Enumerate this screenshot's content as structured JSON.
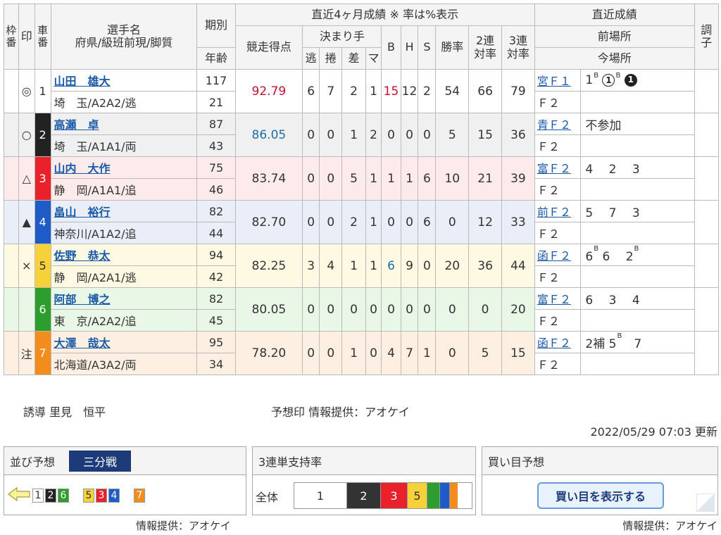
{
  "header": {
    "frame": "枠\n番",
    "mark": "印",
    "car": "車\n番",
    "rider": "選手名",
    "rider_sub": "府県/級班前現/脚質",
    "term": "期別",
    "age": "年齢",
    "recent4": "直近4ヶ月成績 ※ 率は%表示",
    "score": "競走得点",
    "kimarite": "決まり手",
    "k1": "逃",
    "k2": "捲",
    "k3": "差",
    "k4": "マ",
    "b": "B",
    "h": "H",
    "s": "S",
    "win": "勝率",
    "ren2": "2連\n対率",
    "ren3": "3連\n対率",
    "recent": "直近成績",
    "prev_venue": "前場所",
    "this_venue": "今場所",
    "condition": "調\n子"
  },
  "riders": [
    {
      "frame": "",
      "mark": "◎",
      "car": "1",
      "name": "山田　雄大",
      "pref": "埼　玉/A2A2/逃",
      "term": "117",
      "age": "21",
      "score": "92.79",
      "k1": "6",
      "k2": "7",
      "k3": "2",
      "k4": "1",
      "b": "15",
      "h": "12",
      "s": "2",
      "win": "54",
      "r2": "66",
      "r3": "79",
      "prev_label": "宮Ｆ１",
      "this_label": "Ｆ２",
      "recent": "1",
      "bg": "#ffffff",
      "frame_bg": "#ffffff",
      "frame_color": "#333",
      "score_color": "#c8102e",
      "b_color": "#c8102e"
    },
    {
      "frame": "",
      "mark": "○",
      "car": "2",
      "name": "高瀬　卓",
      "pref": "埼　玉/A1A1/両",
      "term": "87",
      "age": "43",
      "score": "86.05",
      "k1": "0",
      "k2": "0",
      "k3": "1",
      "k4": "2",
      "b": "0",
      "h": "0",
      "s": "0",
      "win": "5",
      "r2": "15",
      "r3": "36",
      "prev_label": "青Ｆ２",
      "this_label": "Ｆ２",
      "recent": "不参加",
      "bg": "#f0f0f0",
      "frame_bg": "#222222",
      "frame_color": "#fff",
      "score_color": "#1a6fa8",
      "b_color": "#333"
    },
    {
      "frame": "",
      "mark": "△",
      "car": "3",
      "name": "山内　大作",
      "pref": "静　岡/A1A1/追",
      "term": "75",
      "age": "46",
      "score": "83.74",
      "k1": "0",
      "k2": "0",
      "k3": "5",
      "k4": "1",
      "b": "1",
      "h": "1",
      "s": "6",
      "win": "10",
      "r2": "21",
      "r3": "39",
      "prev_label": "富Ｆ２",
      "this_label": "Ｆ２",
      "recent": "4　 2　 3",
      "bg": "#fdeaea",
      "frame_bg": "#e8212b",
      "frame_color": "#fff",
      "score_color": "#333",
      "b_color": "#333"
    },
    {
      "frame": "",
      "mark": "▲",
      "car": "4",
      "name": "畠山　裕行",
      "pref": "神奈川/A1A2/追",
      "term": "82",
      "age": "44",
      "score": "82.70",
      "k1": "0",
      "k2": "0",
      "k3": "2",
      "k4": "1",
      "b": "0",
      "h": "0",
      "s": "6",
      "win": "0",
      "r2": "12",
      "r3": "33",
      "prev_label": "前Ｆ２",
      "this_label": "Ｆ２",
      "recent": "5　 7　 3",
      "bg": "#e9eef9",
      "frame_bg": "#1f5bc6",
      "frame_color": "#fff",
      "score_color": "#333",
      "b_color": "#333"
    },
    {
      "frame": "",
      "mark": "×",
      "car": "5",
      "name": "佐野　恭太",
      "pref": "静　岡/A2A1/逃",
      "term": "94",
      "age": "42",
      "score": "82.25",
      "k1": "3",
      "k2": "4",
      "k3": "1",
      "k4": "1",
      "b": "6",
      "h": "9",
      "s": "0",
      "win": "20",
      "r2": "36",
      "r3": "44",
      "prev_label": "函Ｆ２",
      "this_label": "Ｆ２",
      "recent": "6",
      "bg": "#fdf9e3",
      "frame_bg": "#f7d13a",
      "frame_color": "#333",
      "score_color": "#333",
      "b_color": "#1a6fa8"
    },
    {
      "frame": "",
      "mark": "",
      "car": "6",
      "name": "阿部　博之",
      "pref": "東　京/A2A2/追",
      "term": "82",
      "age": "45",
      "score": "80.05",
      "k1": "0",
      "k2": "0",
      "k3": "0",
      "k4": "0",
      "b": "0",
      "h": "0",
      "s": "0",
      "win": "0",
      "r2": "0",
      "r3": "20",
      "prev_label": "富Ｆ２",
      "this_label": "Ｆ２",
      "recent": "6　 3　 4",
      "bg": "#e8f7e6",
      "frame_bg": "#2d9e2d",
      "frame_color": "#fff",
      "score_color": "#333",
      "b_color": "#333"
    },
    {
      "frame": "",
      "mark": "注",
      "car": "7",
      "name": "大澤　哉太",
      "pref": "北海道/A3A2/両",
      "term": "95",
      "age": "34",
      "score": "78.20",
      "k1": "0",
      "k2": "0",
      "k3": "1",
      "k4": "0",
      "b": "4",
      "h": "7",
      "s": "1",
      "win": "0",
      "r2": "5",
      "r3": "15",
      "prev_label": "函Ｆ２",
      "this_label": "Ｆ２",
      "recent": "2補",
      "bg": "#fdf0e3",
      "frame_bg": "#f28c1c",
      "frame_color": "#fff",
      "score_color": "#333",
      "b_color": "#333"
    }
  ],
  "recent_extra": {
    "r1_b1": "B",
    "r1_c2": "1",
    "r1_b2": "B",
    "r1_c3": "1",
    "r5_b1": "B",
    "r5_p2": "6",
    "r5_p3": "2",
    "r5_b3": "B",
    "r7_p2": "5",
    "r7_b2": "B",
    "r7_p3": "7"
  },
  "footer": {
    "lead": "誘導 里見　恒平",
    "mark_source": "予想印 情報提供：アオケイ",
    "updated": "2022/05/29 07:03 更新",
    "credit_left": "情報提供：アオケイ",
    "credit_right": "情報提供：アオケイ"
  },
  "line_box": {
    "title": "並び予想",
    "tag": "三分戦",
    "groups": [
      [
        "1",
        "2",
        "6"
      ],
      [
        "5",
        "3",
        "4"
      ],
      [
        "7"
      ]
    ]
  },
  "support_box": {
    "title": "3連単支持率",
    "label": "全体",
    "segments": [
      {
        "text": "1",
        "color": "#ffffff",
        "fg": "#333"
      },
      {
        "text": "2",
        "color": "#333333",
        "fg": "#fff"
      },
      {
        "text": "3",
        "color": "#e8212b",
        "fg": "#fff"
      },
      {
        "text": "5",
        "color": "#f7d13a",
        "fg": "#333"
      },
      {
        "text": "",
        "color": "#2d9e2d",
        "fg": "#fff"
      },
      {
        "text": "",
        "color": "#1f5bc6",
        "fg": "#fff"
      },
      {
        "text": "",
        "color": "#f28c1c",
        "fg": "#fff"
      }
    ]
  },
  "bet_box": {
    "title": "買い目予想",
    "button": "買い目を表示する"
  }
}
